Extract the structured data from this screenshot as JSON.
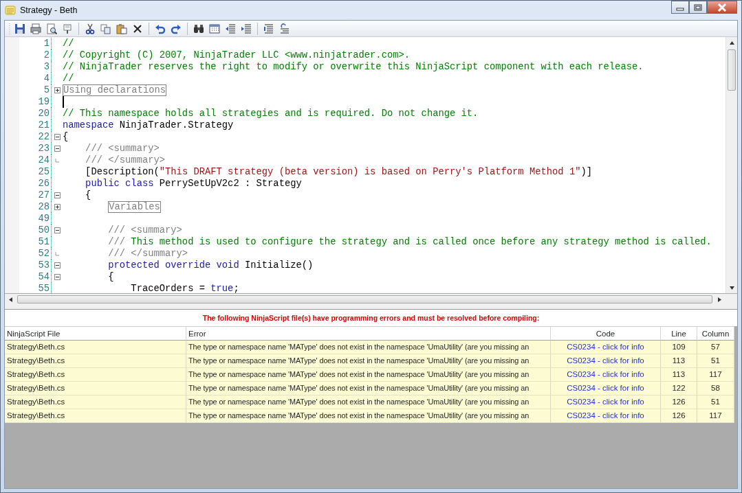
{
  "window": {
    "title": "Strategy - Beth"
  },
  "toolbar": [
    {
      "kind": "save"
    },
    {
      "kind": "print"
    },
    {
      "kind": "preview"
    },
    {
      "kind": "pin"
    },
    {
      "kind": "sep"
    },
    {
      "kind": "cut"
    },
    {
      "kind": "copy"
    },
    {
      "kind": "paste"
    },
    {
      "kind": "delete"
    },
    {
      "kind": "sep"
    },
    {
      "kind": "undo"
    },
    {
      "kind": "redo"
    },
    {
      "kind": "sep"
    },
    {
      "kind": "find"
    },
    {
      "kind": "grid"
    },
    {
      "kind": "outdent"
    },
    {
      "kind": "indent"
    },
    {
      "kind": "sep"
    },
    {
      "kind": "comment"
    },
    {
      "kind": "uncomment"
    }
  ],
  "editor": {
    "lines": [
      {
        "number": "1",
        "kind": "none",
        "cursor": false,
        "tokens": [
          {
            "kind": "comment",
            "text": "//"
          }
        ]
      },
      {
        "number": "2",
        "kind": "none",
        "cursor": false,
        "tokens": [
          {
            "kind": "comment",
            "text": "// Copyright (C) 2007, NinjaTrader LLC <www.ninjatrader.com>."
          }
        ]
      },
      {
        "number": "3",
        "kind": "none",
        "cursor": false,
        "tokens": [
          {
            "kind": "comment",
            "text": "// NinjaTrader reserves the right to modify or overwrite this NinjaScript component with each release."
          }
        ]
      },
      {
        "number": "4",
        "kind": "none",
        "cursor": false,
        "tokens": [
          {
            "kind": "comment",
            "text": "//"
          }
        ]
      },
      {
        "number": "5",
        "kind": "plus",
        "cursor": false,
        "tokens": [
          {
            "kind": "region",
            "text": "Using declarations"
          }
        ]
      },
      {
        "number": "19",
        "kind": "none",
        "cursor": true
      },
      {
        "number": "20",
        "kind": "none",
        "cursor": false,
        "tokens": [
          {
            "kind": "comment",
            "text": "// This namespace holds all strategies and is required. Do not change it."
          }
        ]
      },
      {
        "number": "21",
        "kind": "none",
        "cursor": false,
        "tokens": [
          {
            "kind": "keyword",
            "text": "namespace"
          },
          {
            "kind": "plain",
            "text": " NinjaTrader.Strategy"
          }
        ]
      },
      {
        "number": "22",
        "kind": "minus",
        "cursor": false,
        "tokens": [
          {
            "kind": "plain",
            "text": "{"
          }
        ]
      },
      {
        "number": "23",
        "kind": "minus",
        "cursor": false,
        "tokens": [
          {
            "kind": "doc",
            "text": "    /// <summary>"
          }
        ]
      },
      {
        "number": "24",
        "kind": "end",
        "cursor": false,
        "tokens": [
          {
            "kind": "doc",
            "text": "    /// </summary>"
          }
        ]
      },
      {
        "number": "25",
        "kind": "none",
        "cursor": false,
        "tokens": [
          {
            "kind": "plain",
            "text": "    [Description("
          },
          {
            "kind": "string",
            "text": "\"This DRAFT strategy (beta version) is based on Perry's Platform Method 1\""
          },
          {
            "kind": "plain",
            "text": ")]"
          }
        ]
      },
      {
        "number": "26",
        "kind": "none",
        "cursor": false,
        "tokens": [
          {
            "kind": "keyword",
            "text": "    public class"
          },
          {
            "kind": "plain",
            "text": " PerrySetUpV2c2 : Strategy"
          }
        ]
      },
      {
        "number": "27",
        "kind": "minus",
        "cursor": false,
        "tokens": [
          {
            "kind": "plain",
            "text": "    {"
          }
        ]
      },
      {
        "number": "28",
        "kind": "plus",
        "cursor": false,
        "tokens": [
          {
            "kind": "region",
            "text": "Variables"
          }
        ]
      },
      {
        "number": "49",
        "kind": "none",
        "cursor": false
      },
      {
        "number": "50",
        "kind": "minus",
        "cursor": false,
        "tokens": [
          {
            "kind": "doc",
            "text": "        /// <summary>"
          }
        ]
      },
      {
        "number": "51",
        "kind": "none",
        "cursor": false,
        "tokens": [
          {
            "kind": "doc",
            "text": "        /// "
          },
          {
            "kind": "comment",
            "text": "This method is used to configure the strategy and is called once before any strategy method is called."
          }
        ]
      },
      {
        "number": "52",
        "kind": "end",
        "cursor": false,
        "tokens": [
          {
            "kind": "doc",
            "text": "        /// </summary>"
          }
        ]
      },
      {
        "number": "53",
        "kind": "minus",
        "cursor": false,
        "tokens": [
          {
            "kind": "keyword",
            "text": "        protected override void"
          },
          {
            "kind": "plain",
            "text": " Initialize()"
          }
        ]
      },
      {
        "number": "54",
        "kind": "minus",
        "cursor": false,
        "tokens": [
          {
            "kind": "plain",
            "text": "        {"
          }
        ]
      },
      {
        "number": "55",
        "kind": "none",
        "cursor": false,
        "tokens": [
          {
            "kind": "plain",
            "text": "            TraceOrders = "
          },
          {
            "kind": "keyword",
            "text": "true"
          },
          {
            "kind": "plain",
            "text": ";"
          }
        ]
      }
    ]
  },
  "errors": {
    "message": "The following NinjaScript file(s) have programming errors and must be resolved before compiling:",
    "columns": [
      "NinjaScript File",
      "Error",
      "Code",
      "Line",
      "Column"
    ],
    "rows": [
      {
        "file": "Strategy\\Beth.cs",
        "error": "The type or namespace name 'MAType' does not exist in the namespace 'UmaUtility' (are you missing an",
        "code": "CS0234 - click for info",
        "line": "109",
        "column": "57"
      },
      {
        "file": "Strategy\\Beth.cs",
        "error": "The type or namespace name 'MAType' does not exist in the namespace 'UmaUtility' (are you missing an",
        "code": "CS0234 - click for info",
        "line": "113",
        "column": "51"
      },
      {
        "file": "Strategy\\Beth.cs",
        "error": "The type or namespace name 'MAType' does not exist in the namespace 'UmaUtility' (are you missing an",
        "code": "CS0234 - click for info",
        "line": "113",
        "column": "117"
      },
      {
        "file": "Strategy\\Beth.cs",
        "error": "The type or namespace name 'MAType' does not exist in the namespace 'UmaUtility' (are you missing an",
        "code": "CS0234 - click for info",
        "line": "122",
        "column": "58"
      },
      {
        "file": "Strategy\\Beth.cs",
        "error": "The type or namespace name 'MAType' does not exist in the namespace 'UmaUtility' (are you missing an",
        "code": "CS0234 - click for info",
        "line": "126",
        "column": "51"
      },
      {
        "file": "Strategy\\Beth.cs",
        "error": "The type or namespace name 'MAType' does not exist in the namespace 'UmaUtility' (are you missing an",
        "code": "CS0234 - click for info",
        "line": "126",
        "column": "117"
      }
    ]
  }
}
